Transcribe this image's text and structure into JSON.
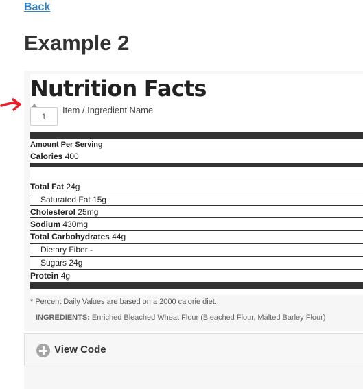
{
  "nav": {
    "back_label": "Back"
  },
  "page": {
    "title": "Example 2"
  },
  "label": {
    "title": "Nutrition Facts",
    "quantity": "1",
    "item_name": "Item / Ingredient Name",
    "amount_per_serving": "Amount Per Serving",
    "calories": {
      "label": "Calories",
      "value": "400"
    },
    "nutrients": [
      {
        "label": "Total Fat",
        "value": "24g"
      },
      {
        "label": "Saturated Fat",
        "value": "15g"
      },
      {
        "label": "Cholesterol",
        "value": "25mg"
      },
      {
        "label": "Sodium",
        "value": "430mg"
      },
      {
        "label": "Total Carbohydrates",
        "value": "44g"
      },
      {
        "label": "Dietary Fiber",
        "value": "-"
      },
      {
        "label": "Sugars",
        "value": "24g"
      },
      {
        "label": "Protein",
        "value": "4g"
      }
    ],
    "footnote": "* Percent Daily Values are based on a 2000 calorie diet.",
    "ingredients_label": "INGREDIENTS:",
    "ingredients_text": "Enriched Bleached Wheat Flour (Bleached Flour, Malted Barley Flour)"
  },
  "code_panel": {
    "label": "View Code",
    "icon": "plus-circle-icon"
  },
  "colors": {
    "link": "#2f7fc1",
    "rule": "#333333",
    "annotation_arrow": "#e8202a"
  }
}
